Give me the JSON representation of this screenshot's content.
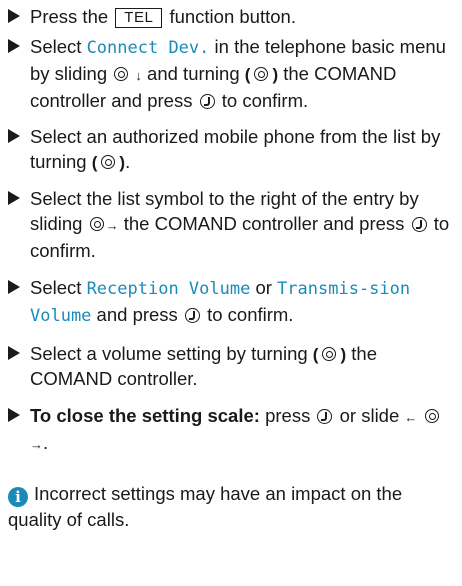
{
  "steps": [
    {
      "t1": "Press the ",
      "key": "TEL",
      "t2": " function button."
    },
    {
      "t1": "Select ",
      "menu": "Connect Dev.",
      "t2": " in the telephone basic menu by sliding ",
      "t3": " and turning ",
      "t4": " the COMAND controller and press ",
      "t5": " to confirm."
    },
    {
      "t1": "Select an authorized mobile phone from the list by turning ",
      "t2": "."
    },
    {
      "t1": "Select the list symbol to the right of the entry by sliding ",
      "t2": " the COMAND controller and press ",
      "t3": " to confirm."
    },
    {
      "t1": "Select ",
      "m1": "Reception Volume",
      "t2": " or ",
      "m2": "Transmis-sion Volume",
      "t3": " and press ",
      "t4": " to confirm."
    },
    {
      "t1": "Select a volume setting by turning ",
      "t2": " the COMAND controller."
    },
    {
      "bold": "To close the setting scale:",
      "t1": " press ",
      "t2": " or slide ",
      "t3": "."
    }
  ],
  "note": {
    "text": "Incorrect settings may have an impact on the quality of calls."
  },
  "symbols": {
    "slide_down": "↓",
    "slide_right": "→",
    "slide_left": "←",
    "turn_left": "(",
    "turn_right": ")",
    "info": "i"
  }
}
